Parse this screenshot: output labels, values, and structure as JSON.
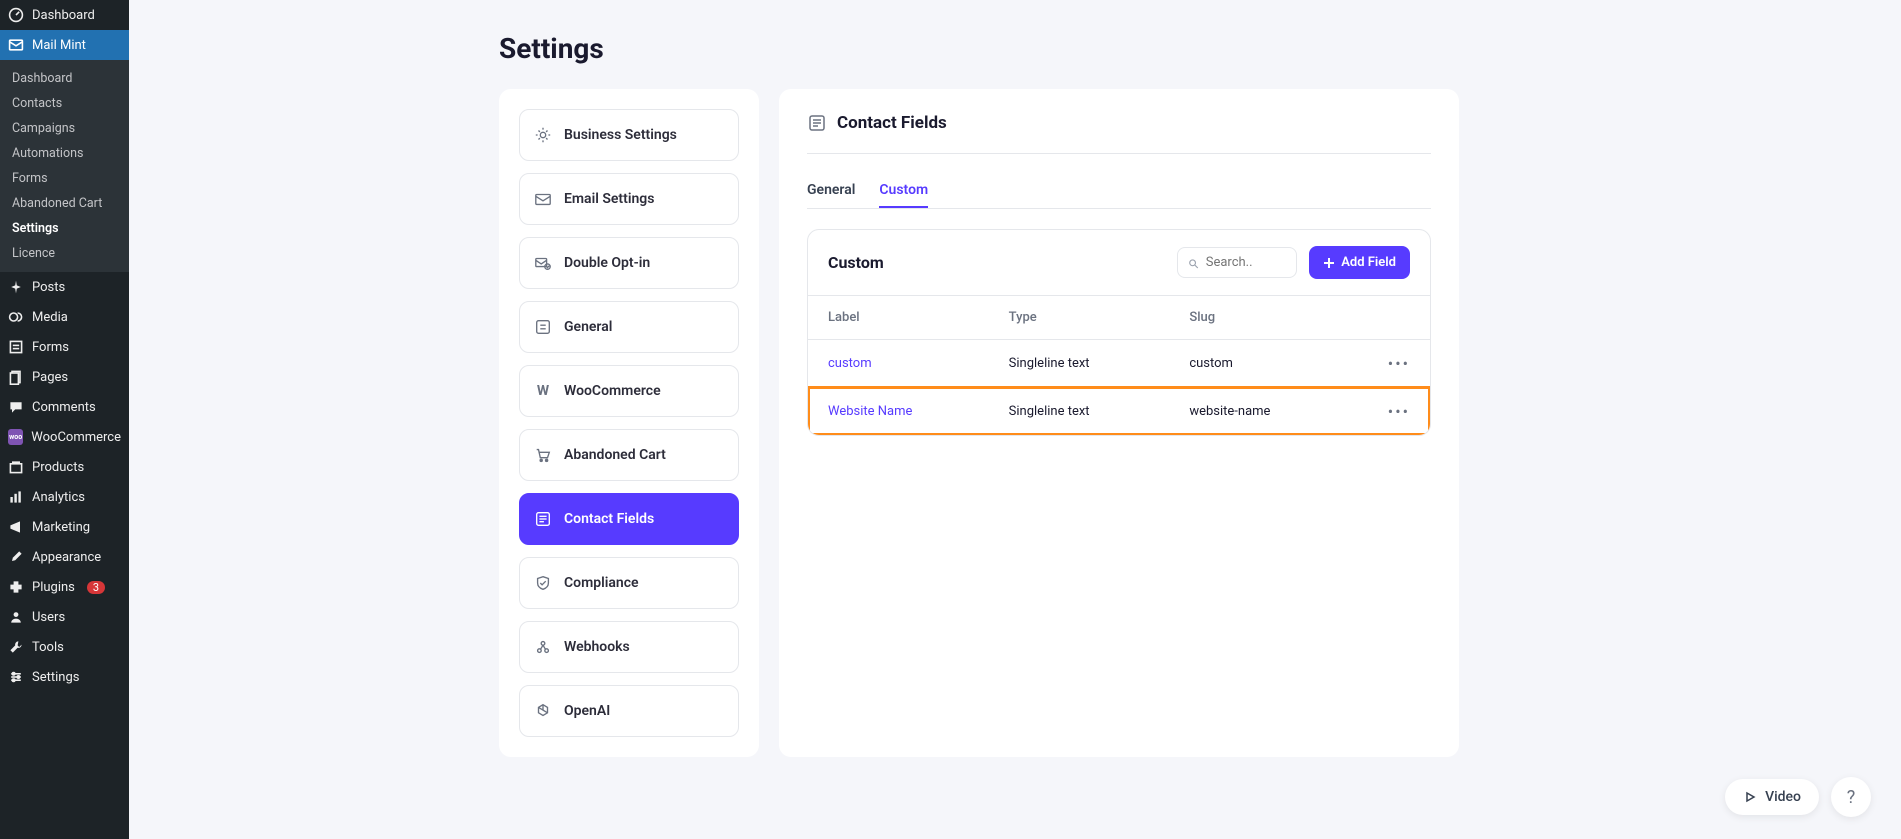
{
  "sidebar": {
    "items": [
      {
        "label": "Dashboard",
        "icon": "dashboard-icon"
      },
      {
        "label": "Mail Mint",
        "icon": "mail-icon",
        "active": true
      },
      {
        "label": "Posts",
        "icon": "pin-icon"
      },
      {
        "label": "Media",
        "icon": "media-icon"
      },
      {
        "label": "Forms",
        "icon": "forms-icon"
      },
      {
        "label": "Pages",
        "icon": "page-icon"
      },
      {
        "label": "Comments",
        "icon": "comment-icon"
      },
      {
        "label": "WooCommerce",
        "icon": "woo-icon"
      },
      {
        "label": "Products",
        "icon": "products-icon"
      },
      {
        "label": "Analytics",
        "icon": "analytics-icon"
      },
      {
        "label": "Marketing",
        "icon": "marketing-icon"
      },
      {
        "label": "Appearance",
        "icon": "brush-icon"
      },
      {
        "label": "Plugins",
        "icon": "plugin-icon",
        "badge": "3"
      },
      {
        "label": "Users",
        "icon": "user-icon"
      },
      {
        "label": "Tools",
        "icon": "tool-icon"
      },
      {
        "label": "Settings",
        "icon": "settings-icon"
      }
    ],
    "sub": [
      {
        "label": "Dashboard"
      },
      {
        "label": "Contacts"
      },
      {
        "label": "Campaigns"
      },
      {
        "label": "Automations"
      },
      {
        "label": "Forms"
      },
      {
        "label": "Abandoned Cart"
      },
      {
        "label": "Settings",
        "active": true
      },
      {
        "label": "Licence"
      }
    ]
  },
  "page": {
    "title": "Settings"
  },
  "settingsNav": [
    {
      "label": "Business Settings",
      "icon": "gear-icon"
    },
    {
      "label": "Email Settings",
      "icon": "envelope-icon"
    },
    {
      "label": "Double Opt-in",
      "icon": "optin-icon"
    },
    {
      "label": "General",
      "icon": "general-icon"
    },
    {
      "label": "WooCommerce",
      "icon": "woo-w-icon"
    },
    {
      "label": "Abandoned Cart",
      "icon": "cart-icon"
    },
    {
      "label": "Contact Fields",
      "icon": "fields-icon",
      "active": true
    },
    {
      "label": "Compliance",
      "icon": "shield-icon"
    },
    {
      "label": "Webhooks",
      "icon": "webhook-icon"
    },
    {
      "label": "OpenAI",
      "icon": "openai-icon"
    }
  ],
  "panel": {
    "title": "Contact Fields",
    "tabs": [
      {
        "label": "General"
      },
      {
        "label": "Custom",
        "active": true
      }
    ],
    "tableTitle": "Custom",
    "searchPlaceholder": "Search..",
    "addButton": "Add Field",
    "columns": [
      "Label",
      "Type",
      "Slug"
    ],
    "rows": [
      {
        "label": "custom",
        "type": "Singleline text",
        "slug": "custom"
      },
      {
        "label": "Website Name",
        "type": "Singleline text",
        "slug": "website-name",
        "highlight": true
      }
    ]
  },
  "float": {
    "video": "Video",
    "help": "?"
  }
}
